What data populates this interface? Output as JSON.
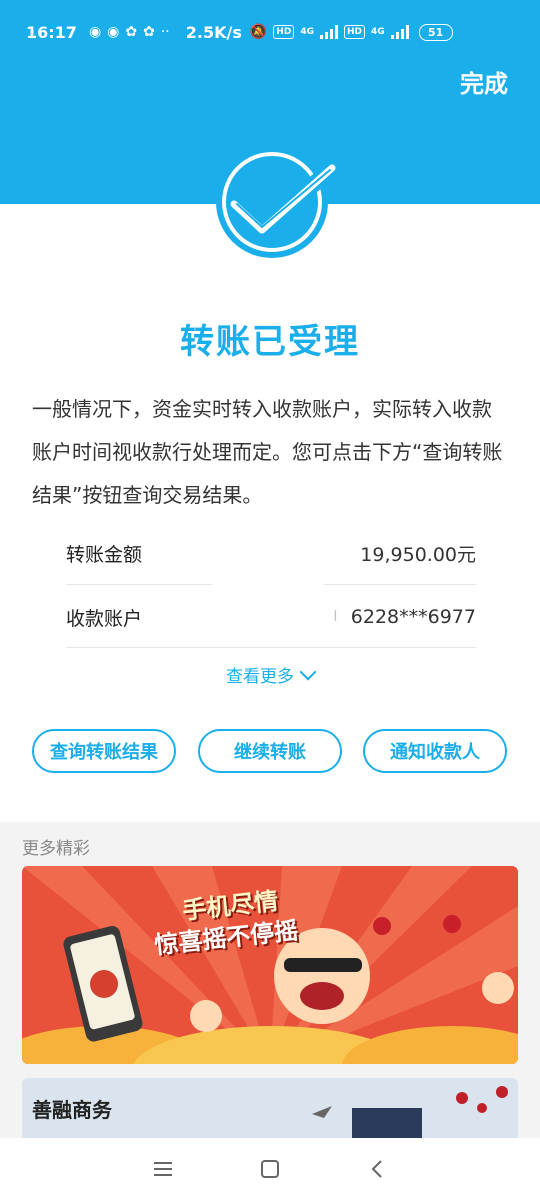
{
  "status_bar": {
    "time": "16:17",
    "speed": "2.5K/s",
    "hd1": "HD",
    "net1": "4G",
    "hd2": "HD",
    "net2": "4G",
    "battery": "51"
  },
  "header": {
    "done_label": "完成"
  },
  "result": {
    "title": "转账已受理",
    "description": "一般情况下，资金实时转入收款账户，实际转入收款账户时间视收款行处理而定。您可点击下方“查询转账结果”按钮查询交易结果。"
  },
  "details": [
    {
      "label": "转账金额",
      "value": "19,950.00元"
    },
    {
      "label": "收款账户",
      "value": "6228***6977"
    }
  ],
  "more_link": "查看更多",
  "actions": {
    "query": "查询转账结果",
    "continue": "继续转账",
    "notify": "通知收款人"
  },
  "promo": {
    "section_title": "更多精彩",
    "banner1_line1": "手机尽情",
    "banner1_line2": "惊喜摇不停摇",
    "banner2_title": "善融商务"
  },
  "colors": {
    "brand": "#1aaeea",
    "banner_red": "#e8523a"
  }
}
